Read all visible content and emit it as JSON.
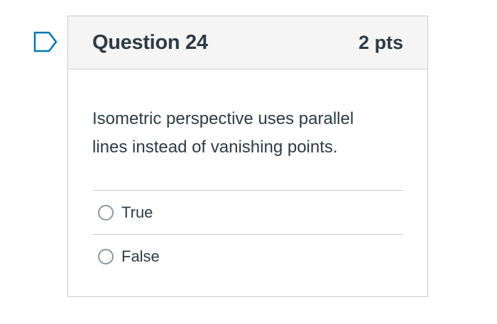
{
  "question": {
    "title": "Question 24",
    "points": "2 pts",
    "text": "Isometric perspective uses parallel lines instead of vanishing points.",
    "flag_icon": "flag-outline-icon"
  },
  "answers": [
    {
      "label": "True",
      "selected": false
    },
    {
      "label": "False",
      "selected": false
    }
  ],
  "colors": {
    "text": "#2d3b45",
    "border": "#c7cdd1",
    "header_bg": "#f5f5f5",
    "flag": "#0374b5"
  }
}
